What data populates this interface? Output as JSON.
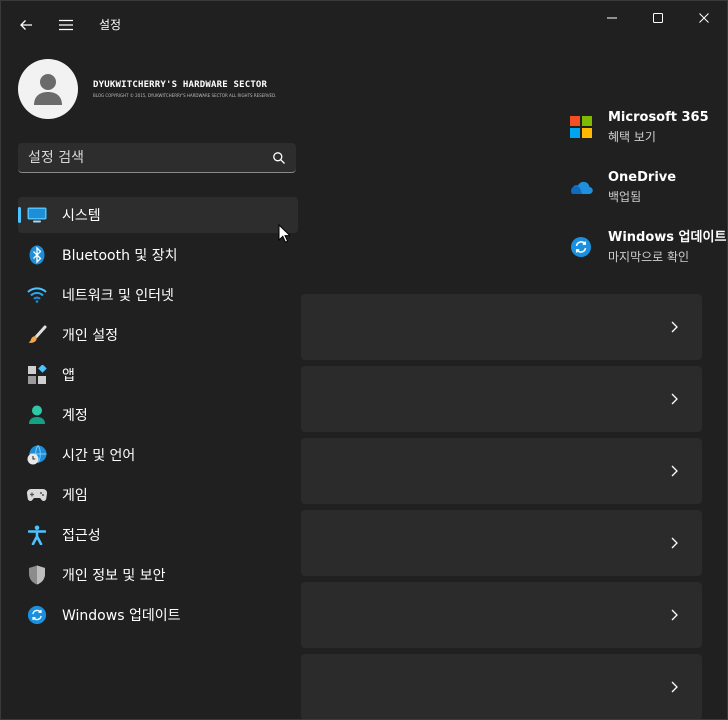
{
  "app": {
    "title": "설정"
  },
  "window_controls": [
    "minimize",
    "maximize",
    "close"
  ],
  "profile": {
    "name": "DYUKWITCHERRY'S HARDWARE SECTOR",
    "subtitle": "BLOG COPYRIGHT © 2015, DYUKWITCHERRY'S HARDWARE SECTOR ALL RIGHTS RESERVED."
  },
  "search": {
    "placeholder": "설정 검색",
    "value": ""
  },
  "nav": {
    "items": [
      {
        "label": "시스템",
        "icon": "monitor-icon",
        "selected": true
      },
      {
        "label": "Bluetooth 및 장치",
        "icon": "bluetooth-icon"
      },
      {
        "label": "네트워크 및 인터넷",
        "icon": "wifi-icon"
      },
      {
        "label": "개인 설정",
        "icon": "brush-icon"
      },
      {
        "label": "앱",
        "icon": "apps-icon"
      },
      {
        "label": "계정",
        "icon": "account-icon"
      },
      {
        "label": "시간 및 언어",
        "icon": "globe-clock-icon"
      },
      {
        "label": "게임",
        "icon": "gamepad-icon"
      },
      {
        "label": "접근성",
        "icon": "accessibility-icon"
      },
      {
        "label": "개인 정보 및 보안",
        "icon": "shield-icon"
      },
      {
        "label": "Windows 업데이트",
        "icon": "update-icon"
      }
    ]
  },
  "quick_links": [
    {
      "title": "Microsoft 365",
      "subtitle": "혜택 보기",
      "icon": "microsoft-logo-icon"
    },
    {
      "title": "OneDrive",
      "subtitle": "백업됨",
      "icon": "onedrive-icon"
    },
    {
      "title": "Windows 업데이트",
      "subtitle": "마지막으로 확인",
      "icon": "update-icon"
    }
  ],
  "cards_count": 6,
  "colors": {
    "background": "#202020",
    "card": "#2b2b2b",
    "accent": "#4cc2ff"
  }
}
